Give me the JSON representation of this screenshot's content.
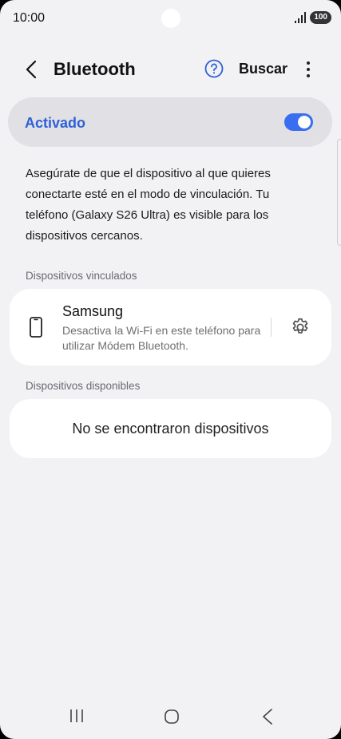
{
  "status_bar": {
    "time": "10:00",
    "battery": "100",
    "icons": [
      "signal-icon",
      "battery-icon"
    ]
  },
  "header": {
    "title": "Bluetooth",
    "search_label": "Buscar",
    "icons": [
      "back-icon",
      "help-icon",
      "more-icon"
    ]
  },
  "toggle": {
    "label": "Activado",
    "state": "on"
  },
  "description": "Asegúrate de que el dispositivo al que quieres conectarte esté en el modo de vinculación. Tu teléfono (Galaxy S26 Ultra) es visible para los dispositivos cercanos.",
  "paired": {
    "section_label": "Dispositivos vinculados",
    "devices": [
      {
        "name": "Samsung",
        "subtitle": "Desactiva la Wi-Fi en este teléfono para utilizar Módem Bluetooth.",
        "icon": "phone-icon",
        "settings_icon": "gear-icon"
      }
    ]
  },
  "available": {
    "section_label": "Dispositivos disponibles",
    "empty_message": "No se encontraron dispositivos"
  },
  "nav_bar": {
    "icons": [
      "recents-icon",
      "home-icon",
      "back-icon"
    ]
  },
  "colors": {
    "accent": "#2f5fd8",
    "switch_on": "#3a6ef0",
    "background": "#f2f2f5",
    "card": "#ffffff"
  }
}
